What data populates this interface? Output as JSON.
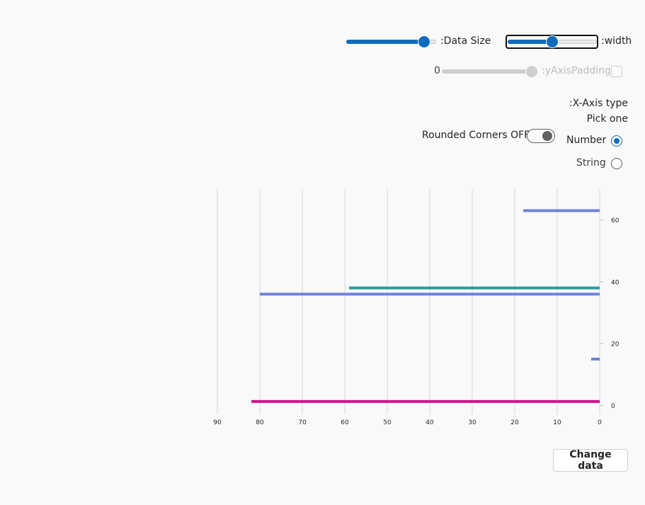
{
  "controls": {
    "data_size_label": ":Data Size",
    "data_size_fraction": 0.87,
    "width_label": ":width",
    "width_fraction": 0.5,
    "y_axis_padding_value": "0",
    "y_axis_padding_label": ":yAxisPadding",
    "y_axis_padding_fraction": 1.0,
    "y_axis_padding_checked": false,
    "x_axis_type_label": ":X-Axis type",
    "pick_one_label": "Pick one",
    "rounded_corners_label": "Rounded Corners OFF",
    "rounded_corners_on": true,
    "radio_options": [
      {
        "label": "Number",
        "checked": true
      },
      {
        "label": "String",
        "checked": false
      }
    ],
    "change_data_label": "Change data"
  },
  "chart_data": {
    "type": "bar",
    "orientation": "horizontal",
    "x_reversed": true,
    "y_position": "right",
    "xlim": [
      0,
      90
    ],
    "ylim": [
      0,
      70
    ],
    "x_ticks": [
      90,
      80,
      70,
      60,
      50,
      40,
      30,
      20,
      10,
      0
    ],
    "y_ticks": [
      60,
      40,
      20,
      0
    ],
    "grid": "vertical",
    "title": "",
    "xlabel": "",
    "ylabel": "",
    "bars": [
      {
        "y": 63,
        "x": 18,
        "color": "#6e82e0"
      },
      {
        "y": 38,
        "x": 59,
        "color": "#2c9c9a"
      },
      {
        "y": 36,
        "x": 80,
        "color": "#6e82e0"
      },
      {
        "y": 15,
        "x": 2,
        "color": "#6e82e0"
      },
      {
        "y": 1.3,
        "x": 82,
        "color": "#d4108a"
      }
    ]
  }
}
